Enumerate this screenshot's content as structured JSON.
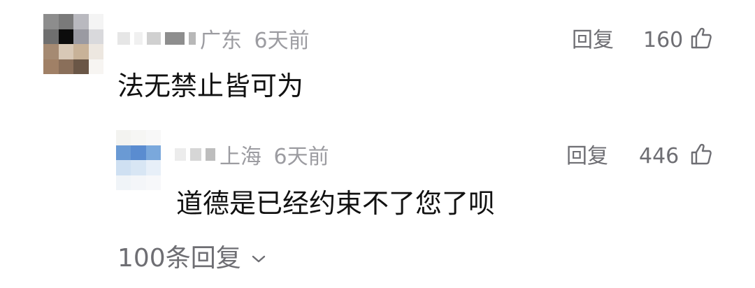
{
  "comment": {
    "location": "广东",
    "time": "6天前",
    "reply_label": "回复",
    "likes": "160",
    "text": "法无禁止皆可为"
  },
  "reply": {
    "location": "上海",
    "time": "6天前",
    "reply_label": "回复",
    "likes": "446",
    "text": "道德是已经约束不了您了呗"
  },
  "more_replies": {
    "label": "100条回复"
  },
  "colors": {
    "meta": "#9c9ca1",
    "action": "#6e6e73",
    "text": "#111111"
  },
  "icons": {
    "like": "thumbs-up-icon",
    "expand": "chevron-down-icon"
  }
}
